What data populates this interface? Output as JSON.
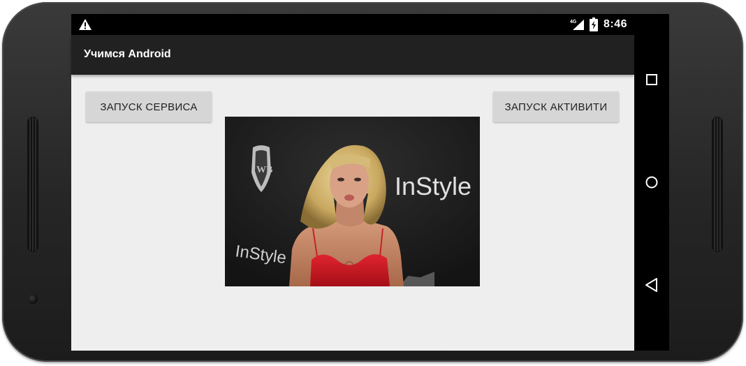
{
  "status_bar": {
    "network_type": "4G",
    "time": "8:46",
    "icons": [
      "warning-icon",
      "signal-icon",
      "battery-icon"
    ]
  },
  "app_bar": {
    "title": "Учимся Android"
  },
  "main": {
    "start_service_label": "ЗАПУСК СЕРВИСА",
    "start_activity_label": "ЗАПУСК АКТИВИТИ",
    "image": {
      "logo_text": "InStyle"
    }
  },
  "nav_bar": {
    "icons": [
      "recent-apps-icon",
      "home-icon",
      "back-icon"
    ]
  },
  "colors": {
    "status_bar": "#000000",
    "app_bar": "#212121",
    "content_bg": "#eeeeee",
    "button_bg": "#d6d6d6",
    "device_body": "#2b2b2b"
  }
}
